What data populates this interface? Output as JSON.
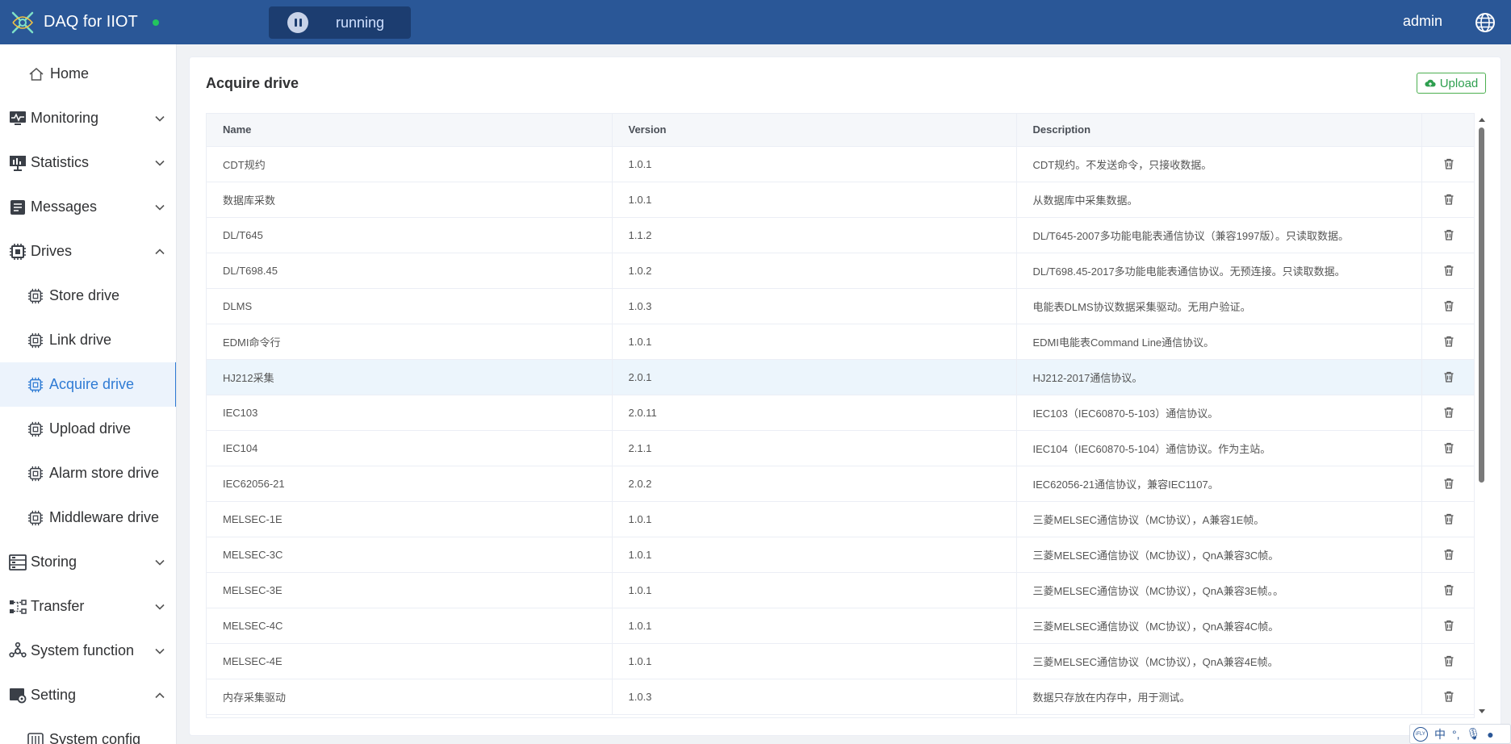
{
  "header": {
    "app_title": "DAQ for IIOT",
    "status_color": "#22c55e",
    "run_status": "running",
    "user": "admin"
  },
  "sidebar": {
    "items": [
      {
        "label": "Home",
        "icon": "home-icon"
      },
      {
        "label": "Monitoring",
        "icon": "monitor-icon"
      },
      {
        "label": "Statistics",
        "icon": "statistics-icon"
      },
      {
        "label": "Messages",
        "icon": "messages-icon"
      },
      {
        "label": "Drives",
        "icon": "chip-icon"
      },
      {
        "label": "Store drive",
        "icon": "chip-icon"
      },
      {
        "label": "Link drive",
        "icon": "chip-icon"
      },
      {
        "label": "Acquire drive",
        "icon": "chip-icon"
      },
      {
        "label": "Upload drive",
        "icon": "chip-icon"
      },
      {
        "label": "Alarm store drive",
        "icon": "chip-icon"
      },
      {
        "label": "Middleware drive",
        "icon": "chip-icon"
      },
      {
        "label": "Storing",
        "icon": "storage-icon"
      },
      {
        "label": "Transfer",
        "icon": "transfer-icon"
      },
      {
        "label": "System function",
        "icon": "function-icon"
      },
      {
        "label": "Setting",
        "icon": "setting-icon"
      },
      {
        "label": "System config",
        "icon": "config-icon"
      }
    ],
    "active": "Acquire drive"
  },
  "main": {
    "title": "Acquire drive",
    "upload_label": "Upload",
    "table": {
      "columns": [
        "Name",
        "Version",
        "Description"
      ],
      "rows": [
        {
          "name": "CDT规约",
          "version": "1.0.1",
          "description": "CDT规约。不发送命令，只接收数据。"
        },
        {
          "name": "数据库采数",
          "version": "1.0.1",
          "description": "从数据库中采集数据。"
        },
        {
          "name": "DL/T645",
          "version": "1.1.2",
          "description": "DL/T645-2007多功能电能表通信协议（兼容1997版）。只读取数据。"
        },
        {
          "name": "DL/T698.45",
          "version": "1.0.2",
          "description": "DL/T698.45-2017多功能电能表通信协议。无预连接。只读取数据。"
        },
        {
          "name": "DLMS",
          "version": "1.0.3",
          "description": "电能表DLMS协议数据采集驱动。无用户验证。"
        },
        {
          "name": "EDMI命令行",
          "version": "1.0.1",
          "description": "EDMI电能表Command Line通信协议。"
        },
        {
          "name": "HJ212采集",
          "version": "2.0.1",
          "description": "HJ212-2017通信协议。"
        },
        {
          "name": "IEC103",
          "version": "2.0.11",
          "description": "IEC103（IEC60870-5-103）通信协议。"
        },
        {
          "name": "IEC104",
          "version": "2.1.1",
          "description": "IEC104（IEC60870-5-104）通信协议。作为主站。"
        },
        {
          "name": "IEC62056-21",
          "version": "2.0.2",
          "description": "IEC62056-21通信协议，兼容IEC1107。"
        },
        {
          "name": "MELSEC-1E",
          "version": "1.0.1",
          "description": "三菱MELSEC通信协议（MC协议），A兼容1E帧。"
        },
        {
          "name": "MELSEC-3C",
          "version": "1.0.1",
          "description": "三菱MELSEC通信协议（MC协议），QnA兼容3C帧。"
        },
        {
          "name": "MELSEC-3E",
          "version": "1.0.1",
          "description": "三菱MELSEC通信协议（MC协议），QnA兼容3E帧。。"
        },
        {
          "name": "MELSEC-4C",
          "version": "1.0.1",
          "description": "三菱MELSEC通信协议（MC协议），QnA兼容4C帧。"
        },
        {
          "name": "MELSEC-4E",
          "version": "1.0.1",
          "description": "三菱MELSEC通信协议（MC协议），QnA兼容4E帧。"
        },
        {
          "name": "内存采集驱动",
          "version": "1.0.3",
          "description": "数据只存放在内存中，用于测试。"
        }
      ],
      "highlighted_row": "HJ212采集"
    }
  },
  "ime": {
    "mode": "中"
  }
}
